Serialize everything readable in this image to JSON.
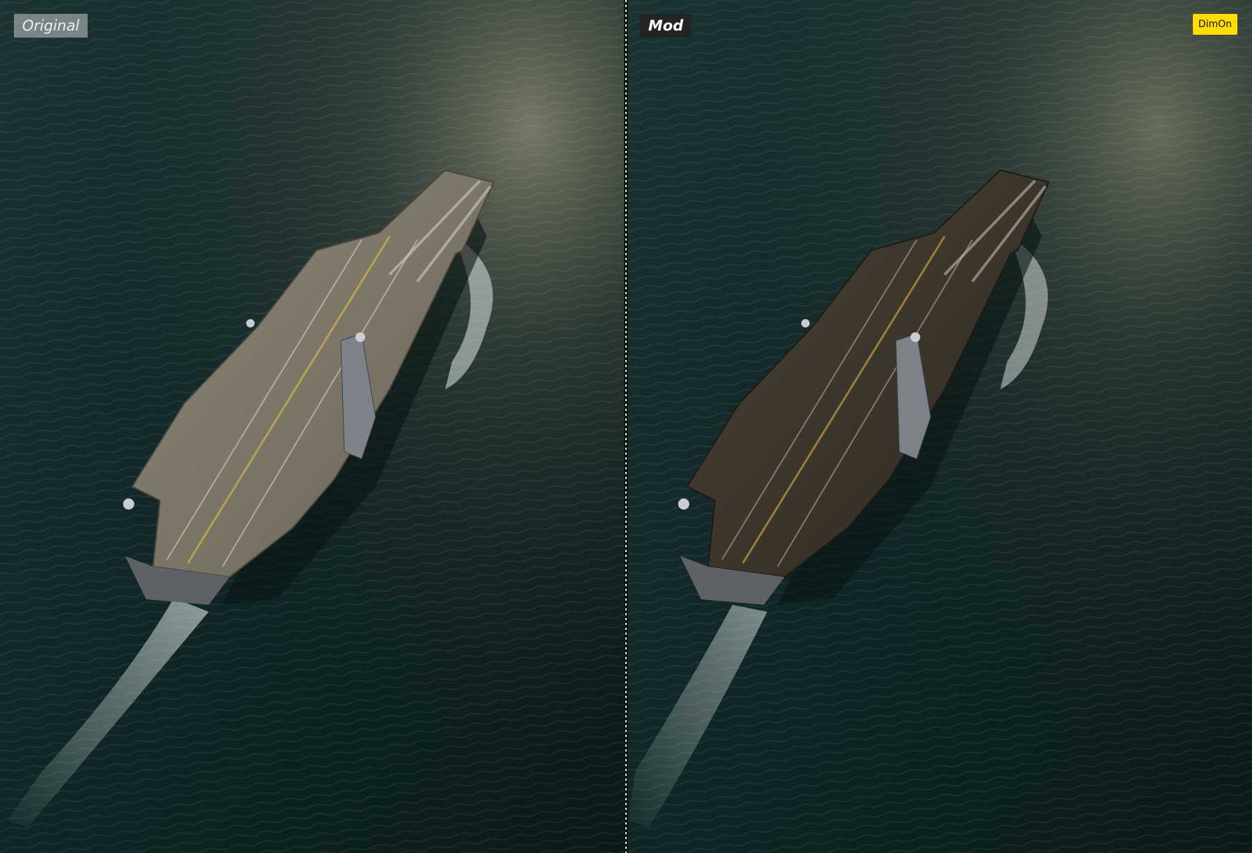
{
  "labels": {
    "original": "Original",
    "mod": "Mod"
  },
  "brand": {
    "name": "DimOn",
    "color": "#ffdd00"
  },
  "scene": {
    "subject": "aircraft-carrier",
    "left_version": "original",
    "right_version": "mod"
  },
  "colors": {
    "water": "#0f2424",
    "deck_original": "#7b7566",
    "deck_mod": "#3b342b",
    "divider": "#ffffff"
  }
}
